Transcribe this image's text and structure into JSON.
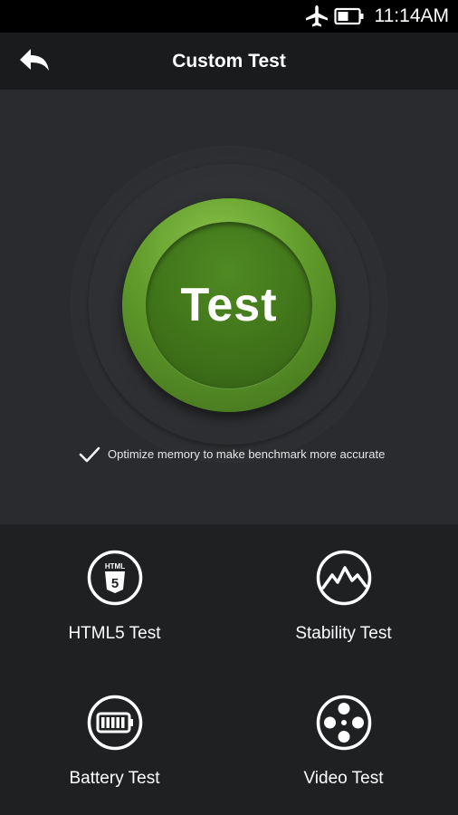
{
  "status_bar": {
    "time": "11:14AM",
    "airplane_icon": "airplane-icon",
    "battery_icon": "battery-icon"
  },
  "app_bar": {
    "back_icon": "back-arrow-icon",
    "title": "Custom Test"
  },
  "hero": {
    "button_label": "Test",
    "optimize": {
      "checked": true,
      "label": "Optimize memory to make benchmark more accurate"
    },
    "accent_color": "#5f9a2a"
  },
  "tools": [
    {
      "label": "HTML5 Test",
      "icon": "html5-icon"
    },
    {
      "label": "Stability Test",
      "icon": "stability-icon"
    },
    {
      "label": "Battery Test",
      "icon": "battery-test-icon"
    },
    {
      "label": "Video Test",
      "icon": "video-reel-icon"
    }
  ]
}
